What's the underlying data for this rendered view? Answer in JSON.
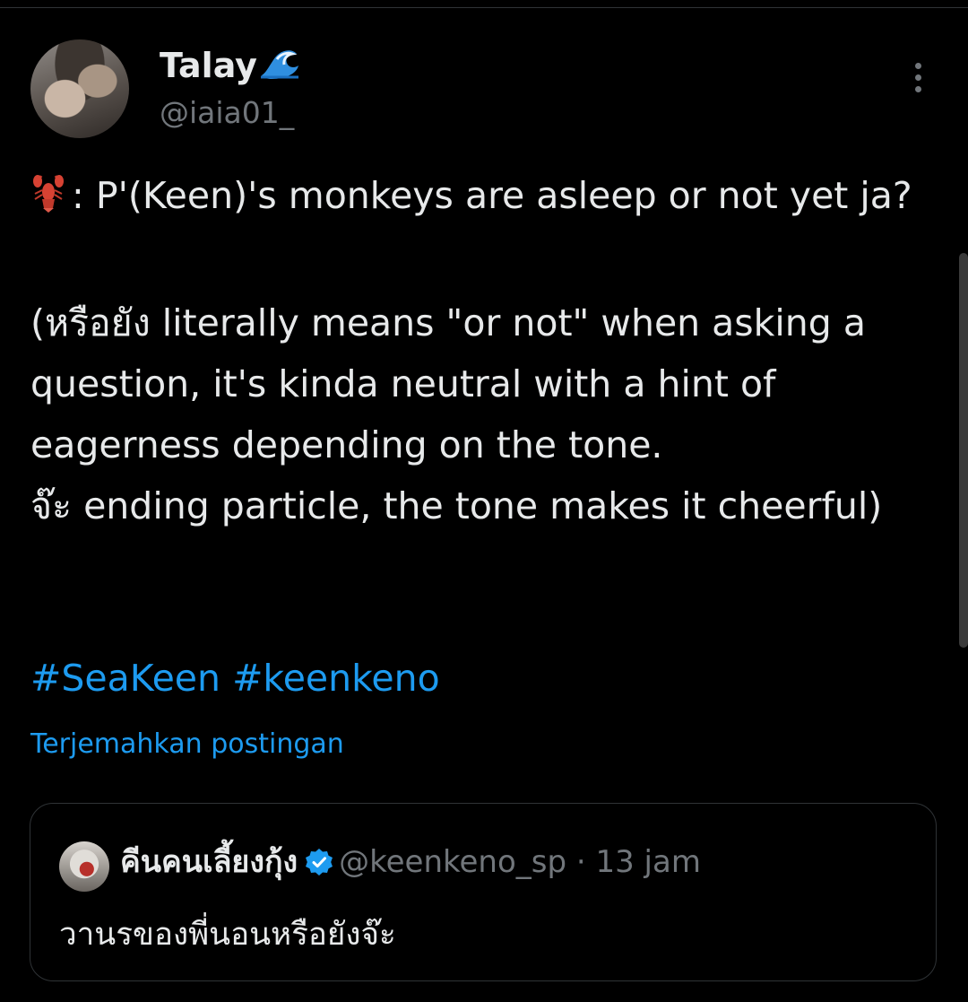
{
  "post": {
    "author_name": "Talay",
    "author_handle": "@iaia01_",
    "text_prefix": ": P'(Keen)'s monkeys are asleep or not yet ja?",
    "text_body": "(หรือยัง literally means \"or not\" when asking a question, it's kinda neutral with a hint of eagerness depending on the tone.\nจ๊ะ ending particle, the tone makes it cheerful)",
    "hashtags": [
      "#SeaKeen",
      "#keenkeno"
    ],
    "translate_label": "Terjemahkan postingan"
  },
  "quote": {
    "author_name": "คีนคนเลี้ยงกุ้ง",
    "author_handle": "@keenkeno_sp",
    "separator": "·",
    "time": "13 jam",
    "text": "วานรของพี่นอนหรือยังจ๊ะ"
  },
  "icons": {
    "name_emoji": "wave-icon",
    "text_emoji": "lobster-icon",
    "more": "more-icon",
    "verified": "verified-badge-icon"
  },
  "colors": {
    "background": "#000000",
    "text": "#e7e9ea",
    "secondary": "#71767b",
    "link": "#1d9bf0",
    "border": "#2f3336"
  }
}
